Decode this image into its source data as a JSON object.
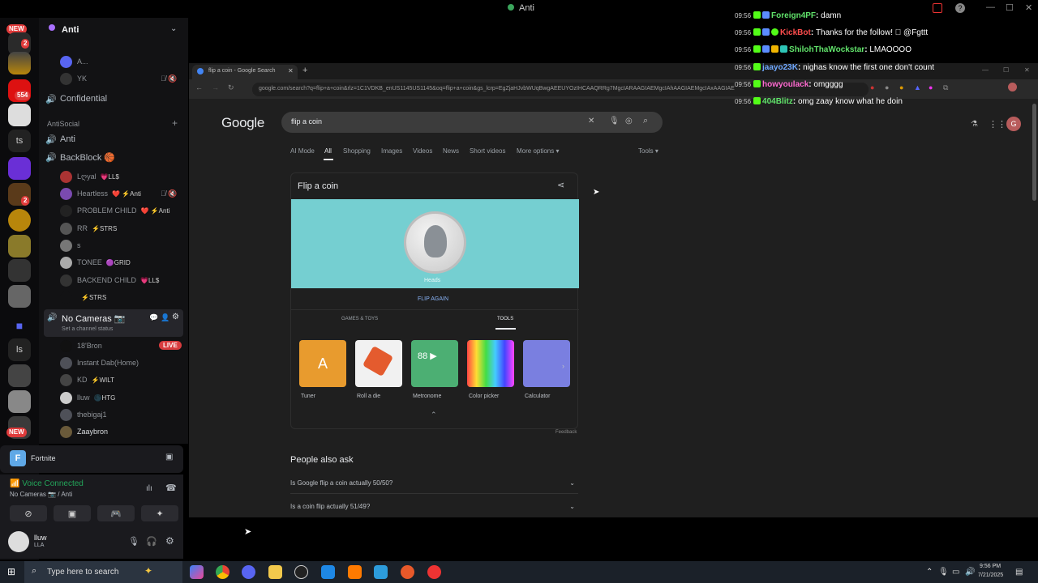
{
  "window": {
    "title": "Anti"
  },
  "chat": [
    {
      "time": "09:56",
      "user": "Foreign4PF",
      "user_color": "#61e36b",
      "msg": "damn"
    },
    {
      "time": "09:56",
      "user": "KickBot",
      "user_color": "#ff4d4d",
      "msg": "Thanks for the follow! 🏾 @Fgttt"
    },
    {
      "time": "09:56",
      "user": "ShilohThaWockstar",
      "user_color": "#61e36b",
      "msg": "LMAOOOO"
    },
    {
      "time": "09:56",
      "user": "jaayo23K",
      "user_color": "#6fa8ff",
      "msg": "nighas know the first one don't count"
    },
    {
      "time": "09:56",
      "user": "howyoulack",
      "user_color": "#ff6bd1",
      "msg": "omgggg"
    },
    {
      "time": "09:56",
      "user": "404Blitz",
      "user_color": "#61e36b",
      "msg": "omg zaay know what he doin"
    }
  ],
  "rail": {
    "new_top": "NEW",
    "new_bottom": "NEW",
    "badge_554": "554",
    "badge_2a": "2",
    "badge_2b": "2",
    "ts": "ts",
    "ls": "ls"
  },
  "channels": {
    "server_name": "Anti",
    "top_users": [
      "A...",
      "YK"
    ],
    "confidential": "Confidential",
    "category": "AntiSocial",
    "ch_anti": "Anti",
    "ch_backblock": "BackBlock 🏀",
    "backblock_users": [
      {
        "name": "Lღyal",
        "tag": "💗LL$"
      },
      {
        "name": "Heartless",
        "tag": "❤️ ⚡Anti"
      },
      {
        "name": "PROBLEM CHILD",
        "tag": "❤️ ⚡Anti"
      },
      {
        "name": "RR",
        "tag": "⚡STRS"
      },
      {
        "name": "s",
        "tag": ""
      },
      {
        "name": "TONEE",
        "tag": "🟣GRID"
      },
      {
        "name": "BACKEND CHILD",
        "tag": "💗LL$"
      },
      {
        "name": "",
        "tag": "⚡STRS"
      }
    ],
    "no_cameras": "No Cameras 📷",
    "channel_status": "Set a channel status",
    "live": "LIVE",
    "nocam_users": [
      {
        "name": "18'Bron",
        "tag": ""
      },
      {
        "name": "Instant Dab(Home)",
        "tag": ""
      },
      {
        "name": "KD",
        "tag": "⚡WILT"
      },
      {
        "name": "lluw",
        "tag": "🌑HTG"
      },
      {
        "name": "thebigaj1",
        "tag": ""
      },
      {
        "name": "Zaaybron",
        "tag": ""
      }
    ]
  },
  "game": {
    "name": "Fortnite"
  },
  "voice": {
    "status": "Voice Connected",
    "channel": "No Cameras 📷 / Anti"
  },
  "user": {
    "name": "lluw",
    "sub": "LLA"
  },
  "browser": {
    "tab_title": "flip a coin - Google Search",
    "url": "google.com/search?q=flip+a+coin&rlz=1C1VDKB_enUS1145US1145&oq=flip+a+coin&gs_lcrp=EgZjaHJvbWUqBwgAEEUYOzIHCAAQRRg7MgcIARAAGIAEMgcIAhAAGIAEMgcIAxAAGIAE"
  },
  "google": {
    "logo": "Google",
    "query": "flip a coin",
    "tabs": [
      "AI Mode",
      "All",
      "Shopping",
      "Images",
      "Videos",
      "News",
      "Short videos",
      "More options ▾"
    ],
    "tools": "Tools ▾",
    "card_title": "Flip a coin",
    "result": "Heads",
    "flip_again": "FLIP AGAIN",
    "sub_tabs": [
      "GAMES & TOYS",
      "TOOLS"
    ],
    "tools_list": [
      "Tuner",
      "Roll a die",
      "Metronome",
      "Color picker",
      "Calculator"
    ],
    "feedback": "Feedback",
    "paa_title": "People also ask",
    "questions": [
      "Is Google flip a coin actually 50/50?",
      "Is a coin flip actually 51/49?"
    ]
  },
  "taskbar": {
    "search_placeholder": "Type here to search",
    "time": "9:56 PM",
    "date": "7/21/2025"
  },
  "colors": {
    "coin_bg": "#75cfd1",
    "discord_bg": "#121214",
    "accent_green": "#23a55a"
  }
}
